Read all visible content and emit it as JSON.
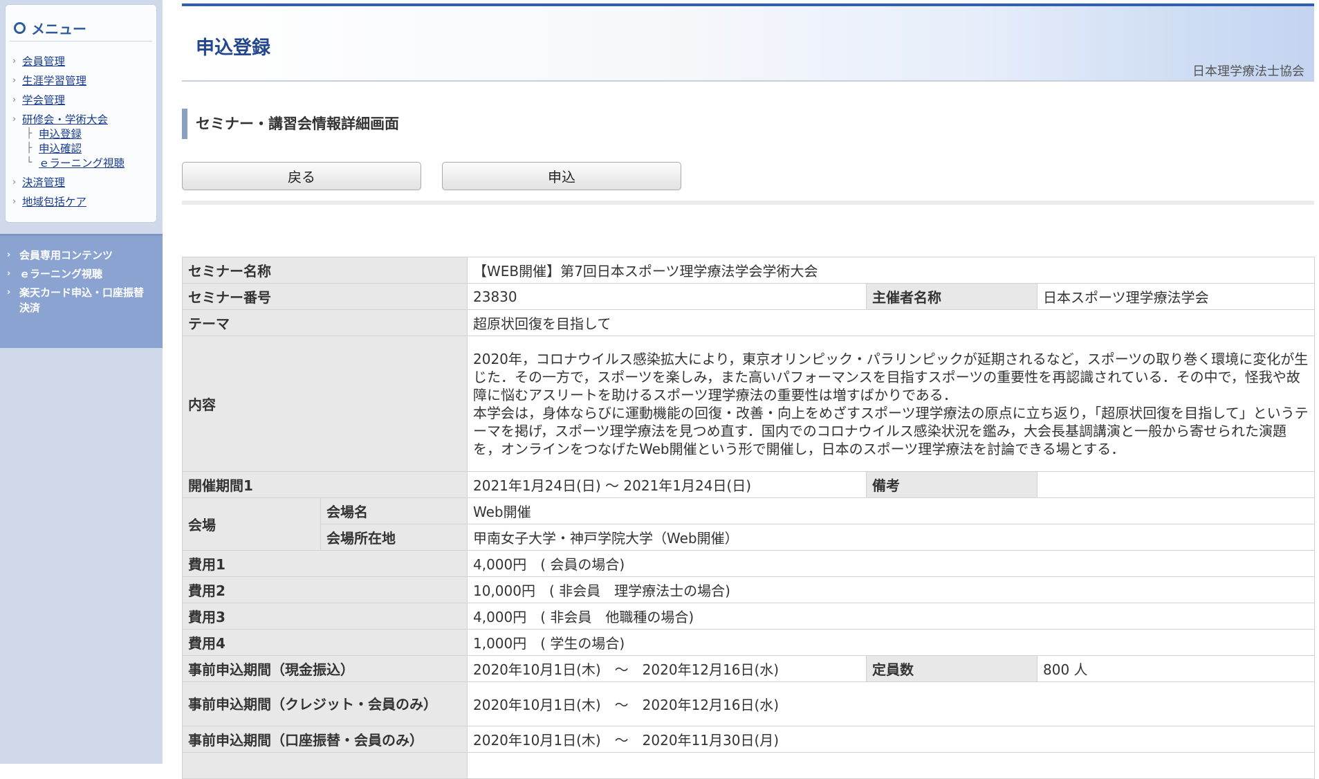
{
  "sidebar": {
    "menu_title": "メニュー",
    "items": [
      {
        "label": "会員管理"
      },
      {
        "label": "生涯学習管理"
      },
      {
        "label": "学会管理"
      },
      {
        "label": "研修会・学術大会"
      },
      {
        "label": "決済管理"
      },
      {
        "label": "地域包括ケア"
      }
    ],
    "sub_items": [
      {
        "label": "申込登録"
      },
      {
        "label": "申込確認"
      },
      {
        "label": "ｅラーニング視聴"
      }
    ],
    "member_items": [
      {
        "label": "会員専用コンテンツ"
      },
      {
        "label": "ｅラーニング視聴"
      },
      {
        "label": "楽天カード申込・口座振替",
        "label2": "決済"
      }
    ]
  },
  "header": {
    "title": "申込登録",
    "org": "日本理学療法士協会"
  },
  "section": {
    "heading": "セミナー・講習会情報詳細画面"
  },
  "buttons": {
    "back": "戻る",
    "apply": "申込"
  },
  "details": {
    "seminar_name_label": "セミナー名称",
    "seminar_name": "【WEB開催】第7回日本スポーツ理学療法学会学術大会",
    "seminar_no_label": "セミナー番号",
    "seminar_no": "23830",
    "organizer_label": "主催者名称",
    "organizer": "日本スポーツ理学療法学会",
    "theme_label": "テーマ",
    "theme": "超原状回復を目指して",
    "content_label": "内容",
    "content_p1": "2020年，コロナウイルス感染拡大により，東京オリンピック・パラリンピックが延期されるなど，スポーツの取り巻く環境に変化が生じた．その一方で，スポーツを楽しみ，また高いパフォーマンスを目指すスポーツの重要性を再認識されている．その中で，怪我や故障に悩むアスリートを助けるスポーツ理学療法の重要性は増すばかりである．",
    "content_p2": "本学会は，身体ならびに運動機能の回復・改善・向上をめざすスポーツ理学療法の原点に立ち返り，「超原状回復を目指して」というテーマを掲げ，スポーツ理学療法を見つめ直す．国内でのコロナウイルス感染状況を鑑み，大会長基調講演と一般から寄せられた演題を，オンラインをつなげたWeb開催という形で開催し，日本のスポーツ理学療法を討論できる場とする．",
    "period_label": "開催期間1",
    "period": "2021年1月24日(日) ～ 2021年1月24日(日)",
    "remarks_label": "備考",
    "remarks": "",
    "venue_label": "会場",
    "venue_name_label": "会場名",
    "venue_name": "Web開催",
    "venue_location_label": "会場所在地",
    "venue_location": "甲南女子大学・神戸学院大学（Web開催）",
    "fee1_label": "費用1",
    "fee1": "4,000円　( 会員の場合)",
    "fee2_label": "費用2",
    "fee2": "10,000円　( 非会員　理学療法士の場合)",
    "fee3_label": "費用3",
    "fee3": "4,000円　( 非会員　他職種の場合)",
    "fee4_label": "費用4",
    "fee4": "1,000円　( 学生の場合)",
    "pre_cash_label": "事前申込期間（現金振込）",
    "pre_cash": "2020年10月1日(木)　～　2020年12月16日(水)",
    "capacity_label": "定員数",
    "capacity": "800 人",
    "pre_credit_label": "事前申込期間（クレジット・会員のみ）",
    "pre_credit": "2020年10月1日(木)　～　2020年12月16日(水)",
    "pre_transfer_label": "事前申込期間（口座振替・会員のみ）",
    "pre_transfer": "2020年10月1日(木)　～　2020年11月30日(月)"
  }
}
